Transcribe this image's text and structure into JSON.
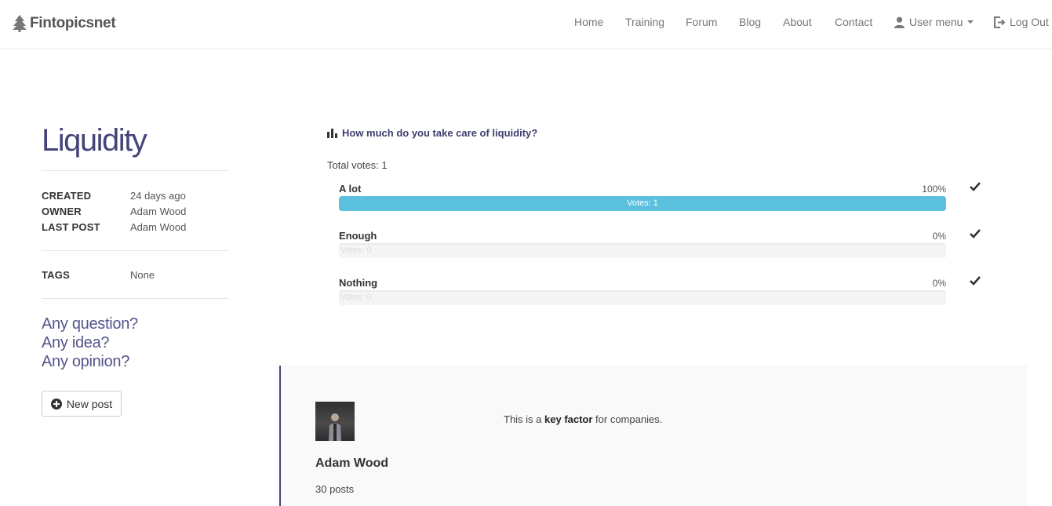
{
  "navbar": {
    "brand": "Fintopicsnet",
    "links": [
      "Home",
      "Training",
      "Forum",
      "Blog",
      "About",
      "Contact"
    ],
    "user_menu": "User menu",
    "logout": "Log Out"
  },
  "topic": {
    "title": "Liquidity",
    "meta": [
      {
        "key": "CREATED",
        "value": "24 days ago"
      },
      {
        "key": "OWNER",
        "value": "Adam Wood"
      },
      {
        "key": "LAST POST",
        "value": "Adam Wood"
      }
    ],
    "tags_key": "TAGS",
    "tags_value": "None"
  },
  "cta": {
    "line1": "Any question?",
    "line2": "Any idea?",
    "line3": "Any opinion?",
    "new_post": "New post"
  },
  "poll": {
    "question": "How much do you take care of liquidity?",
    "total_votes": "Total votes: 1",
    "options": [
      {
        "label": "A lot",
        "percent": "100%",
        "fraction": 1.0,
        "bar_text": "Votes: 1"
      },
      {
        "label": "Enough",
        "percent": "0%",
        "fraction": 0.0,
        "bar_text": "Votes: 0"
      },
      {
        "label": "Nothing",
        "percent": "0%",
        "fraction": 0.0,
        "bar_text": "Votes: 0"
      }
    ],
    "bar_color": "#5bc0de"
  },
  "post": {
    "author": "Adam Wood",
    "post_count": "30 posts",
    "text_before": "This is a ",
    "text_bold": "key factor",
    "text_after": " for companies."
  },
  "colors": {
    "accent": "#45457a",
    "nav_text": "#777777"
  }
}
